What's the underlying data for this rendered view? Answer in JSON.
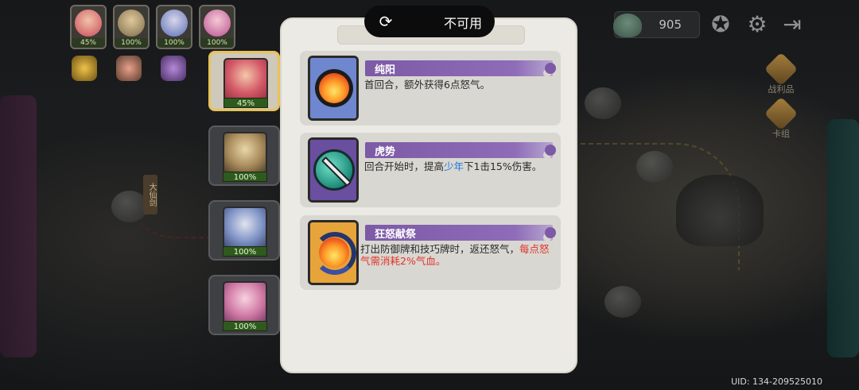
{
  "modal": {
    "tab_label": "",
    "status_pill": {
      "label": "不可用",
      "icon": "refresh-icon"
    },
    "skills": [
      {
        "name": "纯阳",
        "icon": "flame-orb-icon",
        "desc_parts": [
          {
            "text": "首回合，额外获得6点怒气。",
            "style": "normal"
          }
        ]
      },
      {
        "name": "虎势",
        "icon": "sword-orb-icon",
        "desc_parts": [
          {
            "text": "回合开始时，提高",
            "style": "normal"
          },
          {
            "text": "少年",
            "style": "blue"
          },
          {
            "text": "下1击15%伤害。",
            "style": "normal"
          }
        ]
      },
      {
        "name": "狂怒献祭",
        "icon": "flame-swirl-icon",
        "desc_parts": [
          {
            "text": "打出防御牌和技巧牌时，返还怒气，",
            "style": "normal"
          },
          {
            "text": "每点怒气需消耗2%气血。",
            "style": "red"
          }
        ]
      }
    ]
  },
  "party": [
    {
      "pct": "45%"
    },
    {
      "pct": "100%"
    },
    {
      "pct": "100%"
    },
    {
      "pct": "100%"
    }
  ],
  "roster": [
    {
      "hp": "45%",
      "selected": true
    },
    {
      "hp": "100%",
      "selected": false
    },
    {
      "hp": "100%",
      "selected": false
    },
    {
      "hp": "100%",
      "selected": false
    }
  ],
  "hud": {
    "currency_amount": "905",
    "side_items": [
      "战利品",
      "卡组"
    ]
  },
  "map": {
    "node_label": "大仙剑"
  },
  "uid": "UID:  134-209525010",
  "colors": {
    "ribbon": "#7c5aa6",
    "highlight_blue": "#1f7ad6",
    "highlight_red": "#e0352d",
    "selected_border": "#e8c25a",
    "hp_bar": "#2f5a1e"
  }
}
